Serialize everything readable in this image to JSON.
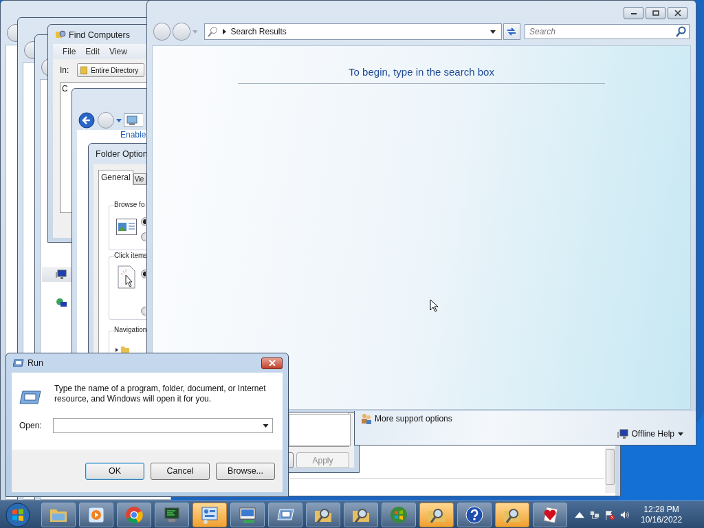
{
  "find_computers": {
    "title": "Find Computers",
    "menu": [
      "File",
      "Edit",
      "View"
    ],
    "in_label": "In:",
    "location": "Entire Directory",
    "list_fragment": "C"
  },
  "explorer": {
    "link_fragment": "Enable",
    "nav_items": [
      {
        "kind": "computer"
      },
      {
        "kind": "network"
      }
    ]
  },
  "folder_options": {
    "title": "Folder Option",
    "tabs": [
      {
        "label": "General",
        "selected": true
      },
      {
        "label": "Vie",
        "selected": false
      }
    ],
    "groups": [
      {
        "label": "Browse fo",
        "options": [
          {
            "selected": true
          },
          {
            "selected": false
          }
        ]
      },
      {
        "label": "Click items",
        "options": [
          {
            "selected": true
          },
          {
            "selected": false
          }
        ]
      },
      {
        "label": "Navigation"
      }
    ],
    "apply": {
      "label": "Apply",
      "disabled": true
    }
  },
  "help_window": {
    "address": "Search Results",
    "search_placeholder": "Search",
    "heading": "To begin, type in the search box",
    "support_link": "More support options",
    "offline_help": "Offline Help"
  },
  "run_dialog": {
    "title": "Run",
    "description": "Type the name of a program, folder, document, or Internet resource, and Windows will open it for you.",
    "open_label": "Open:",
    "buttons": [
      {
        "label": "OK",
        "default": true
      },
      {
        "label": "Cancel",
        "default": false
      },
      {
        "label": "Browse...",
        "default": false
      }
    ]
  },
  "taskbar": {
    "items": [
      {
        "kind": "folder",
        "active": false
      },
      {
        "kind": "media",
        "active": false
      },
      {
        "kind": "chrome",
        "active": false
      },
      {
        "kind": "monitor",
        "active": false
      },
      {
        "kind": "control",
        "active": true
      },
      {
        "kind": "display",
        "active": false
      },
      {
        "kind": "run",
        "active": false
      },
      {
        "kind": "search",
        "active": false
      },
      {
        "kind": "search",
        "active": false
      },
      {
        "kind": "windows",
        "active": false
      },
      {
        "kind": "search",
        "active": true
      },
      {
        "kind": "help",
        "active": false
      },
      {
        "kind": "search",
        "active": true
      },
      {
        "kind": "hearts",
        "active": false
      }
    ],
    "clock": {
      "time": "12:28 PM",
      "date": "10/16/2022"
    }
  }
}
